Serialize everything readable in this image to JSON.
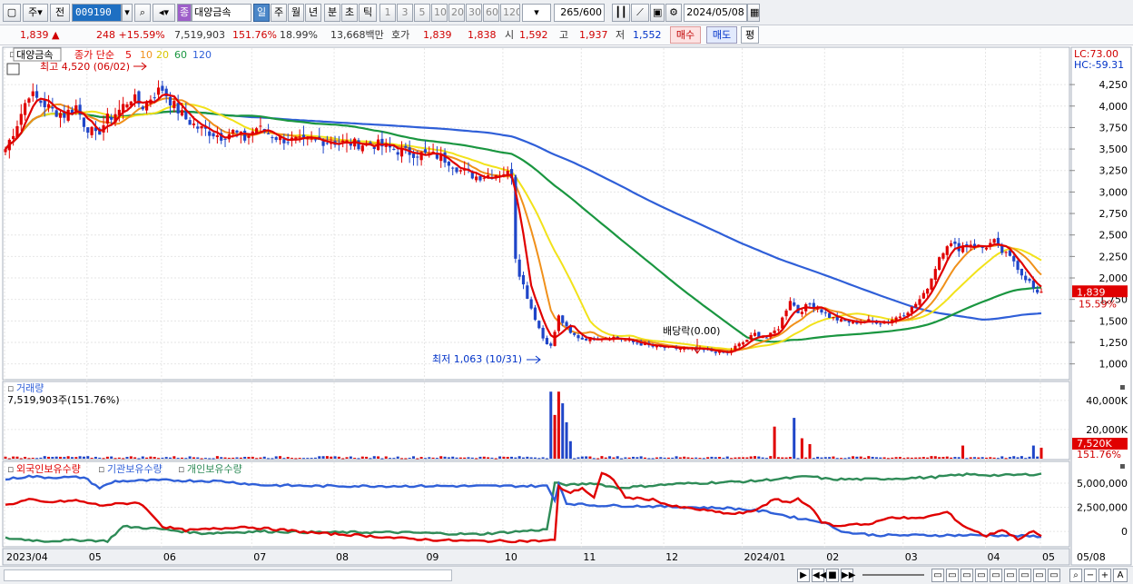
{
  "toolbar": {
    "type_label": "주",
    "prev_label": "전",
    "stock_code": "009190",
    "stock_badge": "종",
    "stock_name": "대양금속",
    "periods": [
      "일",
      "주",
      "월",
      "년",
      "분",
      "초",
      "틱"
    ],
    "intervals": [
      "1",
      "3",
      "5",
      "10",
      "20",
      "30",
      "60",
      "120"
    ],
    "count": "265",
    "count_max": "/600",
    "date": "2024/05/08"
  },
  "info": {
    "price": "1,839 ▲",
    "change": "248 +15.59%",
    "volume": "7,519,903",
    "vol_ratio": "151.76%",
    "turnover": "18.99%",
    "amount": "13,668백만",
    "quote_label": "호가",
    "ask": "1,839",
    "bid": "1,838",
    "open_label": "시",
    "open": "1,592",
    "high_label": "고",
    "high": "1,937",
    "low_label": "저",
    "low": "1,552",
    "buy_label": "매수",
    "sell_label": "매도",
    "avg_label": "평"
  },
  "price_panel": {
    "stock_name": "대양금속",
    "ma_label": "종가 단순",
    "ma_periods": [
      "5",
      "10",
      "20",
      "60",
      "120"
    ],
    "ma_colors": [
      "#e00000",
      "#f0901a",
      "#f2e21a",
      "#1a9640",
      "#2f5fd8"
    ],
    "high_marker": "최고 4,520 (06/02)",
    "low_marker": "최저 1,063 (10/31)",
    "dividend_marker": "배당락(0.00)",
    "lc": "LC:73.00",
    "hc": "HC:-59.31",
    "current_price": "1,839",
    "current_change": "15.59%"
  },
  "volume_panel": {
    "title": "거래량",
    "value": "7,519,903주(151.76%)",
    "current": "7,520K",
    "ratio": "151.76%"
  },
  "holding_panel": {
    "foreign": "외국인보유수량",
    "institution": "기관보유수량",
    "individual": "개인보유수량",
    "colors": {
      "foreign": "#e00000",
      "institution": "#2f5fd8",
      "individual": "#2e8b57"
    }
  },
  "x_axis": [
    "2023/04",
    "05",
    "06",
    "07",
    "08",
    "09",
    "10",
    "11",
    "12",
    "2024/01",
    "02",
    "03",
    "04",
    "05"
  ],
  "x_axis_right": "05/08",
  "chart_data": {
    "type": "candlestick",
    "price_ticks": [
      "4,250",
      "4,000",
      "3,750",
      "3,500",
      "3,250",
      "3,000",
      "2,750",
      "2,500",
      "2,250",
      "2,000",
      "1,750",
      "1,500",
      "1,250",
      "1,000"
    ],
    "price_range": [
      880,
      4600
    ],
    "volume_ticks": [
      "40,000K",
      "20,000K"
    ],
    "volume_range": [
      0,
      48000
    ],
    "holding_ticks": [
      "5,000,000",
      "2,500,000",
      "0"
    ],
    "holding_range": [
      -1500000,
      6500000
    ],
    "close_keys": [
      [
        0,
        3500
      ],
      [
        3,
        3800
      ],
      [
        6,
        4150
      ],
      [
        9,
        4050
      ],
      [
        12,
        3950
      ],
      [
        15,
        3900
      ],
      [
        18,
        4000
      ],
      [
        20,
        3800
      ],
      [
        23,
        3650
      ],
      [
        26,
        3850
      ],
      [
        29,
        3950
      ],
      [
        32,
        4100
      ],
      [
        35,
        4000
      ],
      [
        38,
        4150
      ],
      [
        40,
        4200
      ],
      [
        43,
        4000
      ],
      [
        46,
        3850
      ],
      [
        49,
        3750
      ],
      [
        52,
        3700
      ],
      [
        55,
        3650
      ],
      [
        58,
        3700
      ],
      [
        61,
        3620
      ],
      [
        64,
        3750
      ],
      [
        67,
        3680
      ],
      [
        70,
        3620
      ],
      [
        73,
        3600
      ],
      [
        76,
        3580
      ],
      [
        80,
        3600
      ],
      [
        85,
        3580
      ],
      [
        90,
        3560
      ],
      [
        95,
        3550
      ],
      [
        100,
        3480
      ],
      [
        103,
        3460
      ],
      [
        106,
        3440
      ],
      [
        110,
        3420
      ],
      [
        113,
        3360
      ],
      [
        116,
        3250
      ],
      [
        120,
        3180
      ],
      [
        124,
        3200
      ],
      [
        127,
        3230
      ],
      [
        129,
        3200
      ],
      [
        130,
        2250
      ],
      [
        131,
        2050
      ],
      [
        134,
        1650
      ],
      [
        137,
        1300
      ],
      [
        139,
        1200
      ],
      [
        141,
        1550
      ],
      [
        144,
        1350
      ],
      [
        147,
        1290
      ],
      [
        151,
        1300
      ],
      [
        155,
        1310
      ],
      [
        160,
        1250
      ],
      [
        165,
        1200
      ],
      [
        170,
        1180
      ],
      [
        175,
        1170
      ],
      [
        180,
        1150
      ],
      [
        184,
        1120
      ],
      [
        186,
        1200
      ],
      [
        188,
        1250
      ],
      [
        191,
        1350
      ],
      [
        194,
        1300
      ],
      [
        197,
        1420
      ],
      [
        200,
        1750
      ],
      [
        202,
        1600
      ],
      [
        205,
        1700
      ],
      [
        207,
        1650
      ],
      [
        210,
        1550
      ],
      [
        213,
        1500
      ],
      [
        216,
        1480
      ],
      [
        220,
        1500
      ],
      [
        224,
        1480
      ],
      [
        228,
        1560
      ],
      [
        231,
        1650
      ],
      [
        234,
        1800
      ],
      [
        236,
        2000
      ],
      [
        238,
        2250
      ],
      [
        240,
        2400
      ],
      [
        243,
        2350
      ],
      [
        246,
        2400
      ],
      [
        249,
        2350
      ],
      [
        252,
        2420
      ],
      [
        254,
        2300
      ],
      [
        257,
        2200
      ],
      [
        259,
        2050
      ],
      [
        261,
        1950
      ],
      [
        263,
        1800
      ],
      [
        264,
        1839
      ]
    ],
    "volume_spikes": [
      [
        139,
        46000
      ],
      [
        140,
        30000
      ],
      [
        141,
        46000
      ],
      [
        142,
        38000
      ],
      [
        143,
        25000
      ],
      [
        144,
        12000
      ],
      [
        196,
        22000
      ],
      [
        201,
        28000
      ],
      [
        203,
        14000
      ],
      [
        205,
        10000
      ],
      [
        244,
        9000
      ],
      [
        262,
        9000
      ],
      [
        264,
        7520
      ]
    ],
    "foreign_keys": [
      [
        0,
        2700
      ],
      [
        6,
        3300
      ],
      [
        10,
        3000
      ],
      [
        18,
        3200
      ],
      [
        24,
        2700
      ],
      [
        34,
        3000
      ],
      [
        38,
        1500
      ],
      [
        40,
        500
      ],
      [
        46,
        100
      ],
      [
        55,
        300
      ],
      [
        60,
        500
      ],
      [
        66,
        300
      ],
      [
        72,
        100
      ],
      [
        80,
        -200
      ],
      [
        90,
        -400
      ],
      [
        100,
        -700
      ],
      [
        110,
        -900
      ],
      [
        120,
        -1000
      ],
      [
        135,
        -1000
      ],
      [
        140,
        -900
      ],
      [
        141,
        4600
      ],
      [
        144,
        4000
      ],
      [
        147,
        4500
      ],
      [
        150,
        3500
      ],
      [
        152,
        6000
      ],
      [
        155,
        5400
      ],
      [
        158,
        3500
      ],
      [
        165,
        3300
      ],
      [
        170,
        2600
      ],
      [
        178,
        2200
      ],
      [
        185,
        1800
      ],
      [
        190,
        2000
      ],
      [
        196,
        3300
      ],
      [
        200,
        3000
      ],
      [
        202,
        3400
      ],
      [
        205,
        2600
      ],
      [
        208,
        1000
      ],
      [
        212,
        500
      ],
      [
        216,
        800
      ],
      [
        220,
        700
      ],
      [
        226,
        1500
      ],
      [
        232,
        1300
      ],
      [
        236,
        1600
      ],
      [
        240,
        2000
      ],
      [
        244,
        600
      ],
      [
        250,
        -500
      ],
      [
        254,
        200
      ],
      [
        258,
        -800
      ],
      [
        262,
        0
      ],
      [
        264,
        -500
      ]
    ],
    "institution_keys": [
      [
        0,
        5400
      ],
      [
        6,
        5700
      ],
      [
        10,
        5600
      ],
      [
        20,
        5600
      ],
      [
        24,
        4500
      ],
      [
        28,
        5200
      ],
      [
        40,
        5300
      ],
      [
        55,
        5200
      ],
      [
        65,
        4800
      ],
      [
        80,
        4700
      ],
      [
        100,
        4700
      ],
      [
        120,
        4700
      ],
      [
        138,
        4700
      ],
      [
        140,
        3200
      ],
      [
        141,
        5000
      ],
      [
        143,
        2900
      ],
      [
        150,
        2700
      ],
      [
        165,
        2600
      ],
      [
        185,
        2400
      ],
      [
        195,
        2000
      ],
      [
        200,
        1500
      ],
      [
        208,
        1000
      ],
      [
        214,
        -100
      ],
      [
        222,
        -400
      ],
      [
        240,
        -400
      ],
      [
        252,
        -400
      ],
      [
        260,
        -500
      ],
      [
        264,
        -500
      ]
    ],
    "individual_keys": [
      [
        0,
        -700
      ],
      [
        10,
        -1000
      ],
      [
        20,
        -900
      ],
      [
        26,
        -1000
      ],
      [
        30,
        500
      ],
      [
        38,
        300
      ],
      [
        50,
        -200
      ],
      [
        65,
        0
      ],
      [
        80,
        -100
      ],
      [
        100,
        -100
      ],
      [
        120,
        -300
      ],
      [
        138,
        200
      ],
      [
        140,
        5000
      ],
      [
        144,
        4800
      ],
      [
        150,
        5000
      ],
      [
        156,
        4500
      ],
      [
        170,
        4900
      ],
      [
        190,
        5200
      ],
      [
        205,
        5700
      ],
      [
        210,
        5400
      ],
      [
        220,
        5400
      ],
      [
        236,
        5600
      ],
      [
        245,
        5900
      ],
      [
        254,
        5800
      ],
      [
        264,
        5950
      ]
    ]
  }
}
